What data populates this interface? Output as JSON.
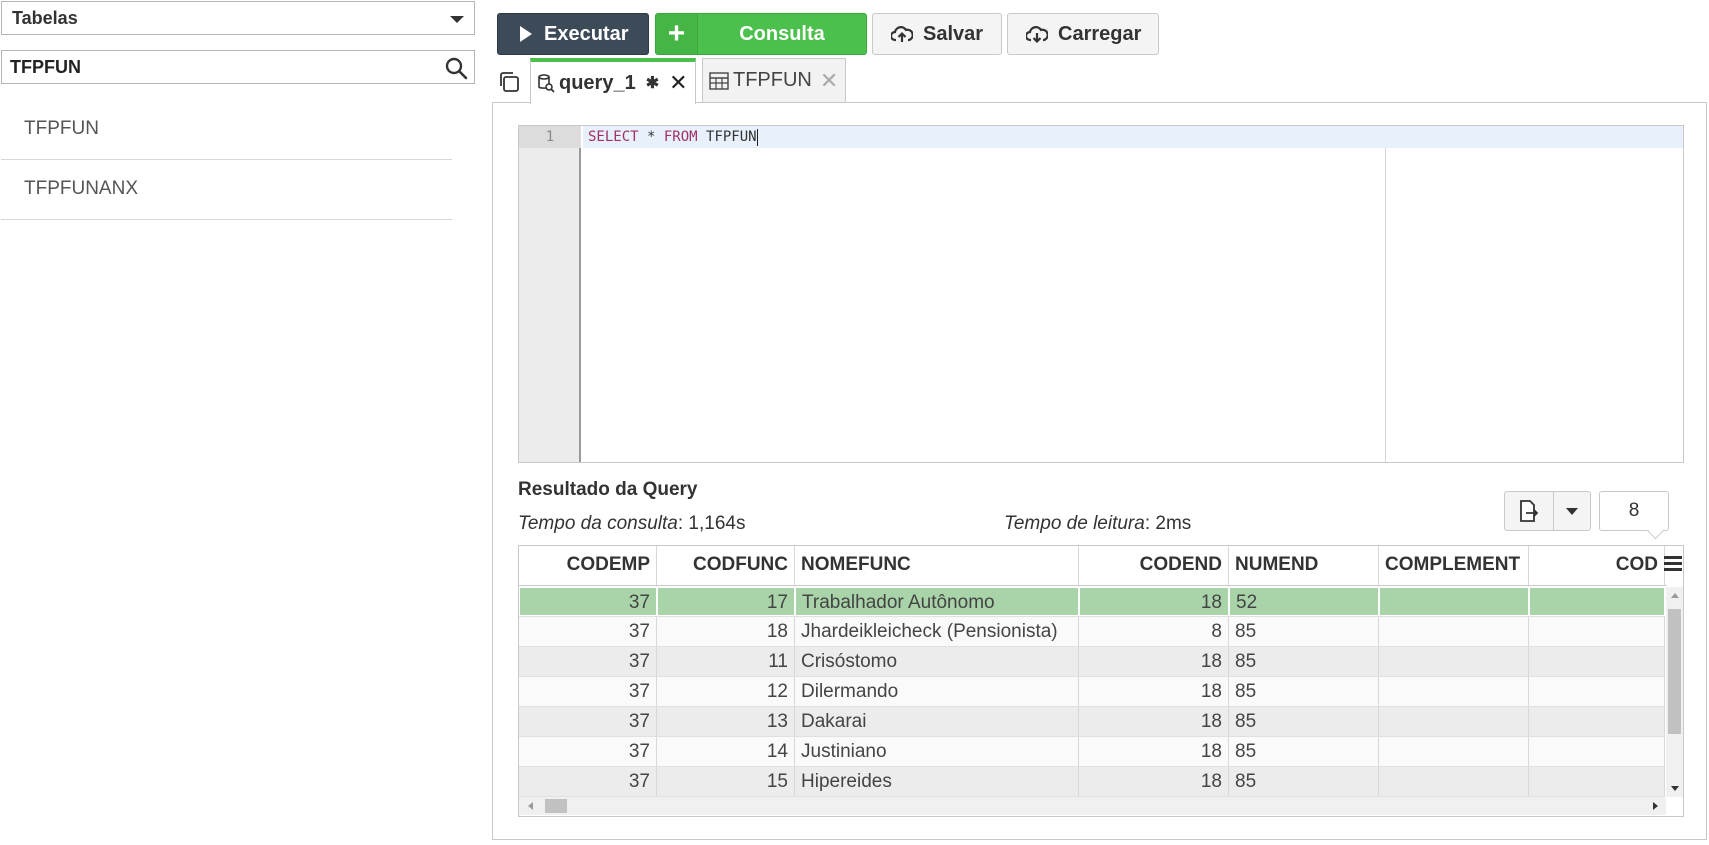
{
  "sidebar": {
    "object_type": "Tabelas",
    "search_value": "TFPFUN",
    "items": [
      {
        "label": "TFPFUN"
      },
      {
        "label": "TFPFUNANX"
      }
    ]
  },
  "toolbar": {
    "execute_label": "Executar",
    "query_label": "Consulta",
    "save_label": "Salvar",
    "load_label": "Carregar"
  },
  "tabs": [
    {
      "label": "query_1",
      "active": true,
      "modified_mark": "✱"
    },
    {
      "label": "TFPFUN",
      "active": false
    }
  ],
  "editor": {
    "line_number": "1",
    "kw_select": "SELECT",
    "star": " * ",
    "kw_from": "FROM",
    "table": " TFPFUN"
  },
  "result": {
    "title": "Resultado da Query",
    "query_time_label": "Tempo da consulta",
    "query_time_value": ": 1,164s",
    "read_time_label": "Tempo de leitura",
    "read_time_value": ": 2ms",
    "page_size": "8",
    "columns": [
      "CODEMP",
      "CODFUNC",
      "NOMEFUNC",
      "CODEND",
      "NUMEND",
      "COMPLEMENT",
      "COD"
    ],
    "rows": [
      [
        "37",
        "17",
        "Trabalhador Autônomo",
        "18",
        "52",
        "",
        ""
      ],
      [
        "37",
        "18",
        "Jhardeikleicheck (Pensionista)",
        "8",
        "85",
        "",
        ""
      ],
      [
        "37",
        "11",
        "Crisóstomo",
        "18",
        "85",
        "",
        ""
      ],
      [
        "37",
        "12",
        "Dilermando",
        "18",
        "85",
        "",
        ""
      ],
      [
        "37",
        "13",
        "Dakarai",
        "18",
        "85",
        "",
        ""
      ],
      [
        "37",
        "14",
        "Justiniano",
        "18",
        "85",
        "",
        ""
      ],
      [
        "37",
        "15",
        "Hipereides",
        "18",
        "85",
        "",
        ""
      ]
    ],
    "selected_row": 0
  },
  "colors": {
    "execute_bg": "#3d4a58",
    "query_bg": "#4cc04c",
    "selected_row": "#a9d3a9",
    "keyword": "#a0306a"
  }
}
